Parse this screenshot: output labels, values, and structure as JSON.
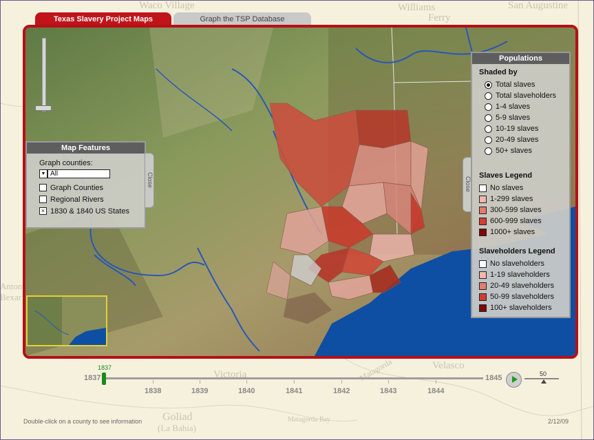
{
  "tabs": [
    {
      "label": "Texas Slavery Project Maps",
      "active": true
    },
    {
      "label": "Graph the TSP Database",
      "active": false
    }
  ],
  "background_labels": {
    "waco": "Waco Village",
    "williams": "Williams",
    "ferry": "Ferry",
    "augustine": "San Augustine",
    "victoria": "Victoria",
    "matagorda": "Matagorda",
    "velasco": "Velasco",
    "goliad": "Goliad",
    "bahia": "(La Bahia)",
    "matagorda_bay": "Matagorda Bay",
    "antonio": "Antonio",
    "bexar": "Bexar"
  },
  "map_features": {
    "title": "Map Features",
    "graph_counties_label": "Graph counties:",
    "dropdown_value": "All",
    "items": [
      {
        "label": "Graph Counties",
        "checked": false
      },
      {
        "label": "Regional Rivers",
        "checked": false
      },
      {
        "label": "1830 & 1840 US States",
        "checked": true
      }
    ],
    "close_label": "Close"
  },
  "populations": {
    "title": "Populations",
    "shaded_by_title": "Shaded by",
    "shaded_options": [
      {
        "label": "Total slaves",
        "selected": true
      },
      {
        "label": "Total slaveholders",
        "selected": false
      },
      {
        "label": "1-4 slaves",
        "selected": false
      },
      {
        "label": "5-9 slaves",
        "selected": false
      },
      {
        "label": "10-19 slaves",
        "selected": false
      },
      {
        "label": "20-49 slaves",
        "selected": false
      },
      {
        "label": "50+ slaves",
        "selected": false
      }
    ],
    "slaves_legend_title": "Slaves Legend",
    "slaves_legend": [
      {
        "label": "No slaves",
        "color": "#ffffff"
      },
      {
        "label": "1-299 slaves",
        "color": "#f3b7ad"
      },
      {
        "label": "300-599 slaves",
        "color": "#e57b6c"
      },
      {
        "label": "600-999 slaves",
        "color": "#d1402e"
      },
      {
        "label": "1000+ slaves",
        "color": "#7a0a08"
      }
    ],
    "slaveholders_legend_title": "Slaveholders Legend",
    "slaveholders_legend": [
      {
        "label": "No slaveholders",
        "color": "#ffffff"
      },
      {
        "label": "1-19 slaveholders",
        "color": "#f3b7ad"
      },
      {
        "label": "20-49 slaveholders",
        "color": "#e57b6c"
      },
      {
        "label": "50-99 slaveholders",
        "color": "#d1402e"
      },
      {
        "label": "100+ slaveholders",
        "color": "#7a0a08"
      }
    ],
    "close_label": "Close"
  },
  "timeline": {
    "current_year": "1837",
    "start_label": "1837",
    "end_label": "1845",
    "years": [
      "1838",
      "1839",
      "1840",
      "1841",
      "1842",
      "1843",
      "1844"
    ],
    "speed_value": "50"
  },
  "footer": {
    "hint": "Double-click on a county to see information",
    "date": "2/12/09"
  }
}
